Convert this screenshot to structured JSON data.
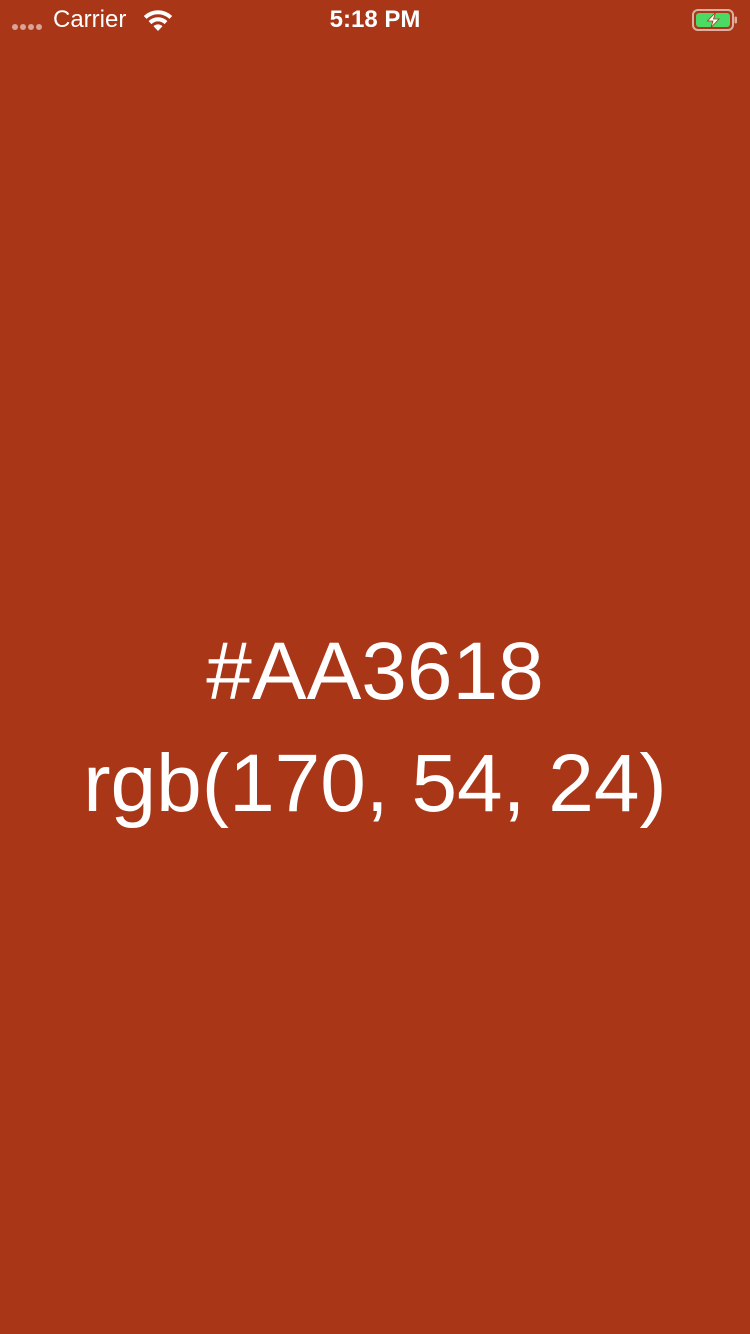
{
  "status_bar": {
    "carrier": "Carrier",
    "time": "5:18 PM",
    "signal_icon": "signal-dots-icon",
    "wifi_icon": "wifi-icon",
    "battery_icon": "battery-charging-icon",
    "battery_color": "#4CD964"
  },
  "color": {
    "background": "#AA3618",
    "hex_label": "#AA3618",
    "rgb_label": "rgb(170, 54, 24)"
  }
}
